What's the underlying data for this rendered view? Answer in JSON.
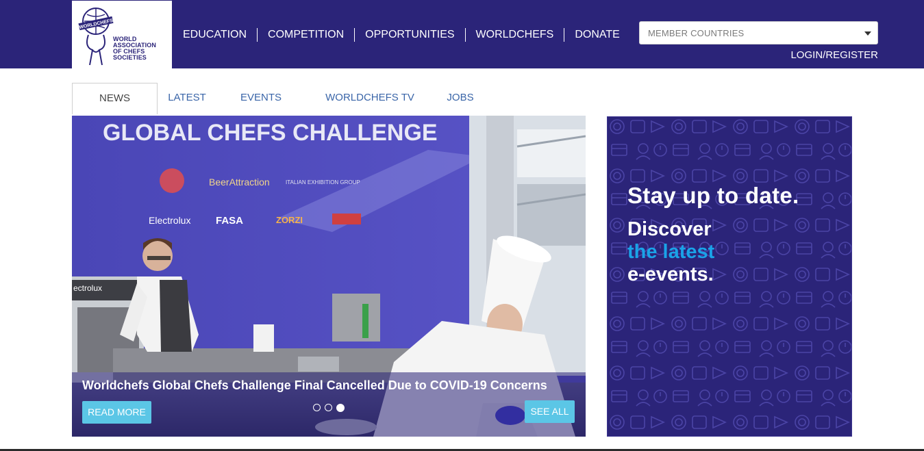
{
  "header": {
    "logo": {
      "badge_text": "WORLDCHEFS",
      "lines": [
        "WORLD",
        "ASSOCIATION",
        "OF CHEFS",
        "SOCIETIES"
      ]
    },
    "nav": [
      "EDUCATION",
      "COMPETITION",
      "OPPORTUNITIES",
      "WORLDCHEFS",
      "DONATE"
    ],
    "member_countries": "MEMBER COUNTRIES",
    "login": "LOGIN/REGISTER"
  },
  "tabs": [
    {
      "label": "NEWS",
      "active": true
    },
    {
      "label": "LATEST",
      "active": false
    },
    {
      "label": "EVENTS",
      "active": false
    },
    {
      "label": "WORLDCHEFS TV",
      "active": false
    },
    {
      "label": "JOBS",
      "active": false
    }
  ],
  "hero": {
    "banner_text": "GLOBAL CHEFS CHALLENGE",
    "sponsor_texts": [
      "BeerAttraction",
      "Electrolux",
      "FASA",
      "ZORZI",
      "ITALIAN EXHIBITION GROUP",
      "ectrolux"
    ],
    "caption": "Worldchefs Global Chefs Challenge Final Cancelled Due to COVID-19 Concerns",
    "read_more": "READ MORE",
    "see_all": "SEE ALL",
    "slides": 3,
    "active_slide": 3
  },
  "ad": {
    "line1": "Stay up to date.",
    "line2": "Discover",
    "line3": "the latest",
    "line4": "e-events."
  },
  "colors": {
    "header_bg": "#2b2479",
    "accent_button": "#5bc6e6",
    "ad_highlight": "#1aa3e8",
    "tab_link": "#3a65a8"
  }
}
